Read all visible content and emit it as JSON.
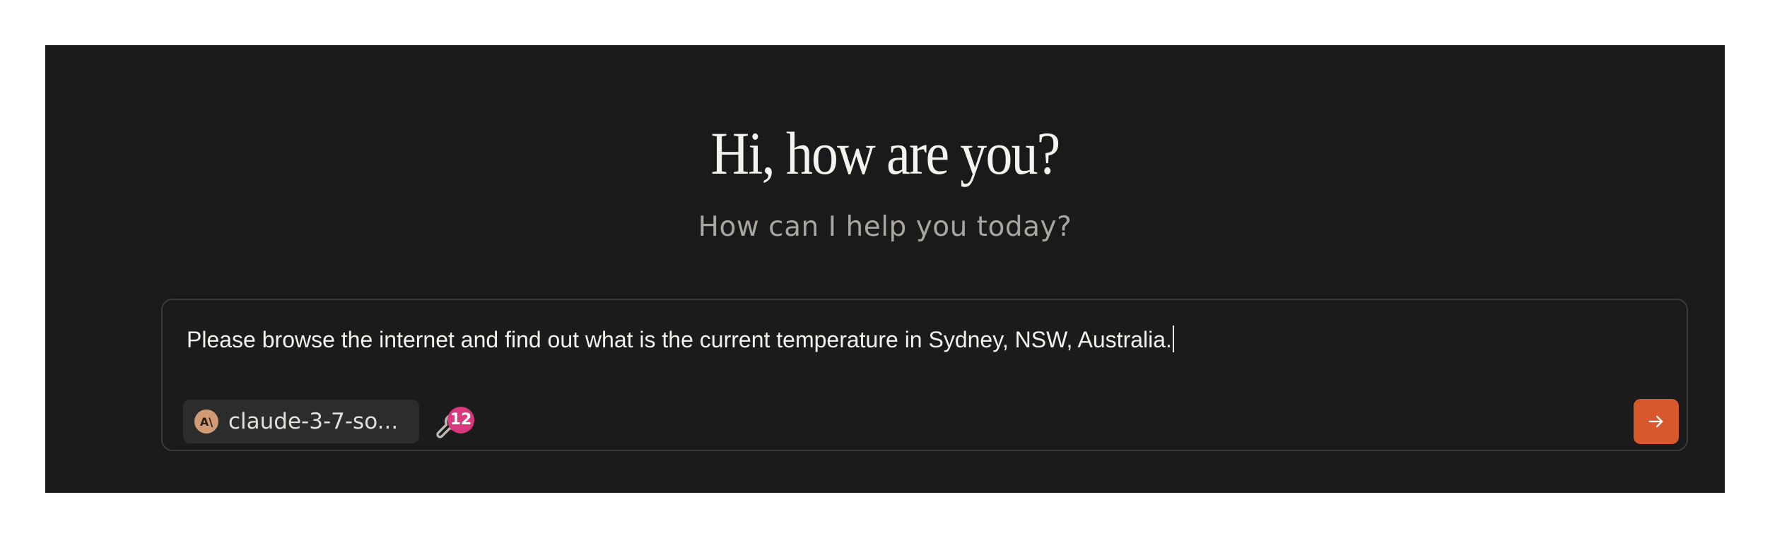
{
  "greeting": {
    "title": "Hi, how are you?",
    "subtitle": "How can I help you today?"
  },
  "composer": {
    "message": "Please browse the internet and find out what is the current temperature in Sydney, NSW, Australia."
  },
  "model": {
    "icon": "anthropic-icon",
    "icon_text": "A\\",
    "label": "claude-3-7-so..."
  },
  "tools": {
    "icon": "wrench-icon",
    "count": "12"
  },
  "send": {
    "icon": "arrow-right-icon"
  },
  "colors": {
    "background": "#1a1a1a",
    "accent": "#d8582e",
    "badge": "#d9387e",
    "model_icon": "#d19b75"
  }
}
